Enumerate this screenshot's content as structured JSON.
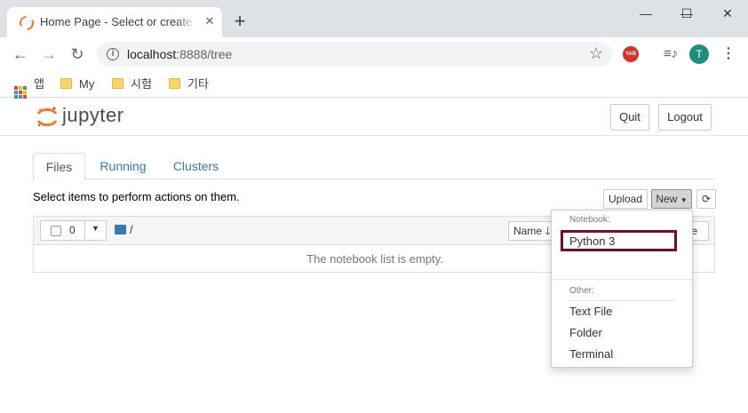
{
  "browser": {
    "tab_title": "Home Page - Select or create a notebook",
    "tab_close": "✕",
    "new_tab": "+",
    "window_controls": {
      "minimize": "—",
      "maximize": "☐",
      "close": "✕"
    },
    "url_host": "localhost",
    "url_rest": ":8888/tree",
    "extension_label": "YAB",
    "profile_initial": "T",
    "icons": [
      "back-icon",
      "forward-icon",
      "reload-icon",
      "info-icon",
      "star-icon",
      "playlist-icon",
      "menu-icon"
    ]
  },
  "bookmarks": {
    "apps": "앱",
    "items": [
      "My",
      "시험",
      "기타"
    ]
  },
  "jupyter": {
    "logo_text": "jupyter",
    "quit": "Quit",
    "logout": "Logout",
    "tabs": [
      {
        "label": "Files",
        "active": true
      },
      {
        "label": "Running",
        "active": false
      },
      {
        "label": "Clusters",
        "active": false
      }
    ],
    "select_text": "Select items to perform actions on them.",
    "upload": "Upload",
    "new": "New",
    "selected_count": "0",
    "breadcrumb": "/",
    "name_sort": "Name",
    "last_modified_partial": "te",
    "empty_message": "The notebook list is empty.",
    "accent_color": "#f37726",
    "link_color": "#337ab7"
  },
  "new_menu": {
    "notebook_header": "Notebook:",
    "notebook_items": [
      "Python 3"
    ],
    "other_header": "Other:",
    "other_items": [
      "Text File",
      "Folder",
      "Terminal"
    ],
    "highlight_color": "#7a0a2b"
  }
}
